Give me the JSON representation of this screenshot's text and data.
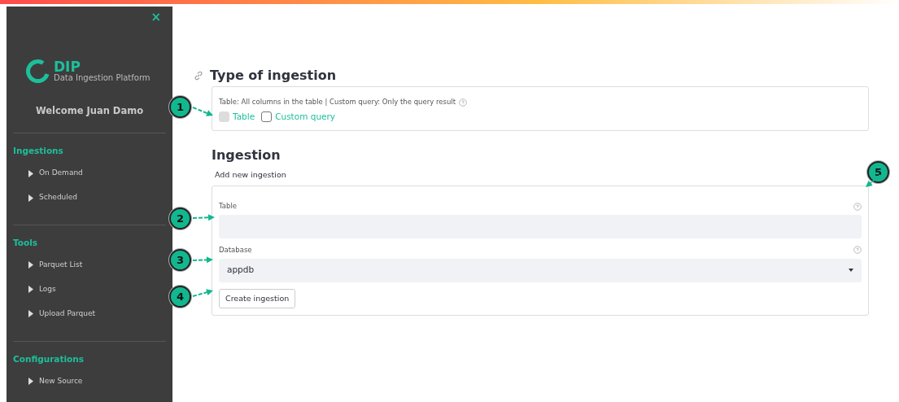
{
  "sidebar": {
    "close": "×",
    "logo": {
      "mark": "DIP",
      "subtitle": "Data Ingestion Platform"
    },
    "welcome": "Welcome Juan Damo",
    "sections": [
      {
        "title": "Ingestions",
        "items": [
          {
            "label": "On Demand"
          },
          {
            "label": "Scheduled"
          }
        ]
      },
      {
        "title": "Tools",
        "items": [
          {
            "label": "Parquet List"
          },
          {
            "label": "Logs"
          },
          {
            "label": "Upload Parquet"
          }
        ]
      },
      {
        "title": "Configurations",
        "items": [
          {
            "label": "New Source"
          }
        ]
      }
    ]
  },
  "type_section": {
    "title": "Type of ingestion",
    "help": "Table: All columns in the table | Custom query: Only the query result",
    "options": [
      {
        "label": "Table",
        "checked": true
      },
      {
        "label": "Custom query",
        "checked": false
      }
    ]
  },
  "ingestion": {
    "title": "Ingestion",
    "subtitle": "Add new ingestion",
    "fields": [
      {
        "kind": "text",
        "label": "Table"
      },
      {
        "kind": "select",
        "label": "Database",
        "value": "appdb"
      }
    ],
    "button": "Create ingestion"
  },
  "callouts": [
    "1",
    "2",
    "3",
    "4",
    "5"
  ]
}
